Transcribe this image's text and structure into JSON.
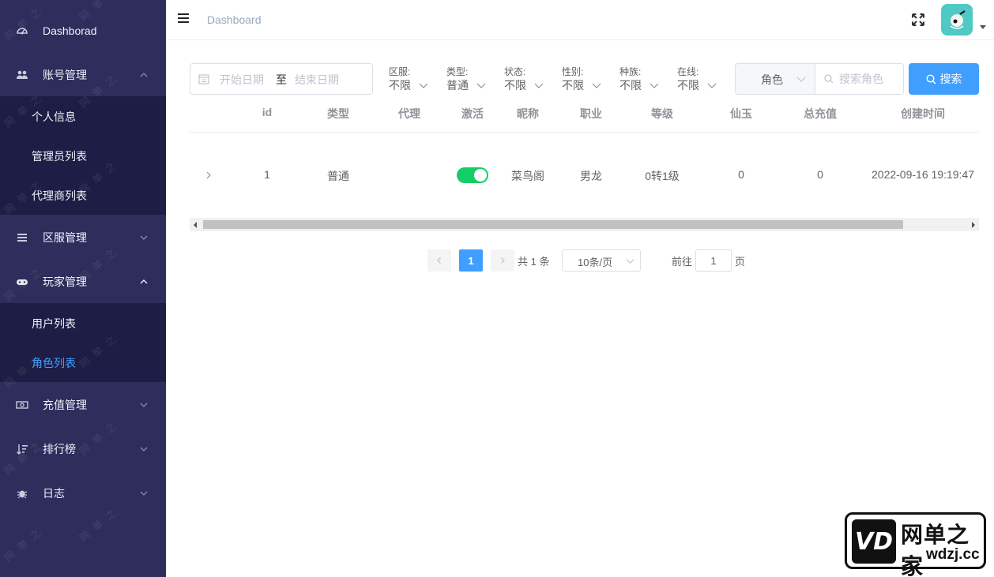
{
  "sidebar": {
    "items": [
      {
        "label": "Dashborad",
        "icon": "dashboard-icon"
      },
      {
        "label": "账号管理",
        "icon": "users-icon",
        "expanded": true,
        "children": [
          {
            "label": "个人信息"
          },
          {
            "label": "管理员列表"
          },
          {
            "label": "代理商列表"
          }
        ]
      },
      {
        "label": "区服管理",
        "icon": "server-list-icon",
        "expanded": false
      },
      {
        "label": "玩家管理",
        "icon": "gamepad-icon",
        "expanded": true,
        "children": [
          {
            "label": "用户列表"
          },
          {
            "label": "角色列表",
            "active": true
          }
        ]
      },
      {
        "label": "充值管理",
        "icon": "money-icon",
        "expanded": false
      },
      {
        "label": "排行榜",
        "icon": "sort-icon",
        "expanded": false
      },
      {
        "label": "日志",
        "icon": "bug-icon",
        "expanded": false
      }
    ]
  },
  "header": {
    "breadcrumb": "Dashboard"
  },
  "filters": {
    "date_start_placeholder": "开始日期",
    "date_separator": "至",
    "date_end_placeholder": "结束日期",
    "server": {
      "label": "区服:",
      "value": "不限"
    },
    "type": {
      "label": "类型:",
      "value": "普通"
    },
    "status": {
      "label": "状态:",
      "value": "不限"
    },
    "gender": {
      "label": "性别:",
      "value": "不限"
    },
    "race": {
      "label": "种族:",
      "value": "不限"
    },
    "online": {
      "label": "在线:",
      "value": "不限"
    },
    "search_field": "角色",
    "search_placeholder": "搜索角色",
    "search_button": "搜索"
  },
  "table": {
    "columns": [
      "id",
      "类型",
      "代理",
      "激活",
      "昵称",
      "职业",
      "等级",
      "仙玉",
      "总充值",
      "创建时间"
    ],
    "rows": [
      {
        "id": "1",
        "type": "普通",
        "agent": "",
        "active": true,
        "nickname": "菜鸟阁",
        "profession": "男龙",
        "level": "0转1级",
        "xianyu": "0",
        "total_recharge": "0",
        "created": "2022-09-16 19:19:47"
      }
    ]
  },
  "pagination": {
    "current": "1",
    "total_text": "共 1 条",
    "page_size": "10条/页",
    "goto_label": "前往",
    "goto_value": "1",
    "page_suffix": "页"
  },
  "watermark_logo": {
    "mark": "VD",
    "name": "网单之家",
    "domain": "wdzj.cc"
  },
  "colors": {
    "sidebar_bg": "#2e2d5c",
    "submenu_bg": "#1e1d45",
    "primary": "#409eff",
    "switch_on": "#13ce66",
    "active_menu": "#409eff"
  }
}
